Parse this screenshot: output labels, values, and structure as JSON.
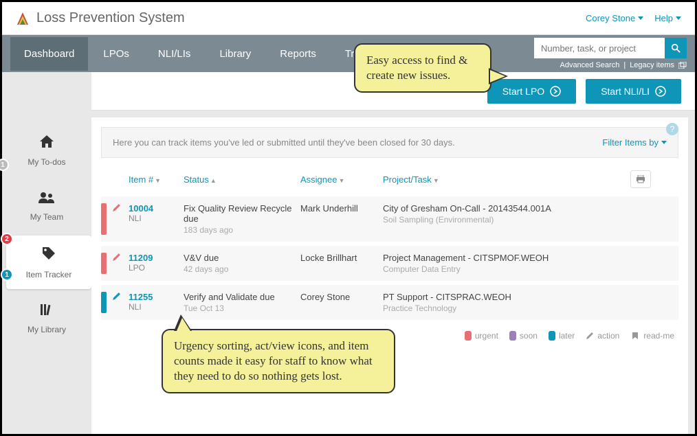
{
  "app": {
    "title": "Loss Prevention System"
  },
  "topbar": {
    "user": "Corey Stone",
    "help": "Help"
  },
  "nav": {
    "items": [
      "Dashboard",
      "LPOs",
      "NLI/LIs",
      "Library",
      "Reports",
      "Training"
    ],
    "active": 0
  },
  "search": {
    "placeholder": "Number, task, or project",
    "advanced": "Advanced Search",
    "legacy": "Legacy items"
  },
  "actions": {
    "start_lpo": "Start LPO",
    "start_nli": "Start NLI/LI"
  },
  "sidebar": {
    "items": [
      {
        "label": "My To-dos",
        "badge": "1",
        "badge_color": "grey"
      },
      {
        "label": "My Team"
      },
      {
        "label": "Item Tracker",
        "badge_top": "2",
        "badge_top_color": "red",
        "badge_bottom": "1",
        "badge_bottom_color": "teal",
        "active": true
      },
      {
        "label": "My Library"
      }
    ]
  },
  "content": {
    "intro": "Here you can track items you've led or submitted until they've been closed for 30 days.",
    "filter": "Filter Items by",
    "headers": {
      "item": "Item #",
      "status": "Status",
      "assignee": "Assignee",
      "project": "Project/Task"
    },
    "rows": [
      {
        "urgency": "red",
        "itemno": "10004",
        "type": "NLI",
        "status": "Fix Quality Review Recycle due",
        "status_sub": "183 days ago",
        "assignee": "Mark Underhill",
        "project": "City of Gresham On-Call - 20143544.001A",
        "project_sub": "Soil Sampling (Environmental)"
      },
      {
        "urgency": "red",
        "itemno": "11209",
        "type": "LPO",
        "status": "V&V due",
        "status_sub": "42 days ago",
        "assignee": "Locke Brillhart",
        "project": "Project Management - CITSPMOF.WEOH",
        "project_sub": "Computer Data Entry"
      },
      {
        "urgency": "teal",
        "itemno": "11255",
        "type": "NLI",
        "status": "Verify and Validate due",
        "status_sub": "Tue Oct 13",
        "assignee": "Corey Stone",
        "project": "PT Support - CITSPRAC.WEOH",
        "project_sub": "Practice Technology"
      }
    ],
    "legend": {
      "urgent": "urgent",
      "soon": "soon",
      "later": "later",
      "action": "action",
      "readme": "read-me"
    }
  },
  "callouts": {
    "c1": "Easy access to find & create new issues.",
    "c2": "Urgency sorting, act/view icons, and item counts made it easy for staff to know what they need to do so nothing gets lost."
  }
}
